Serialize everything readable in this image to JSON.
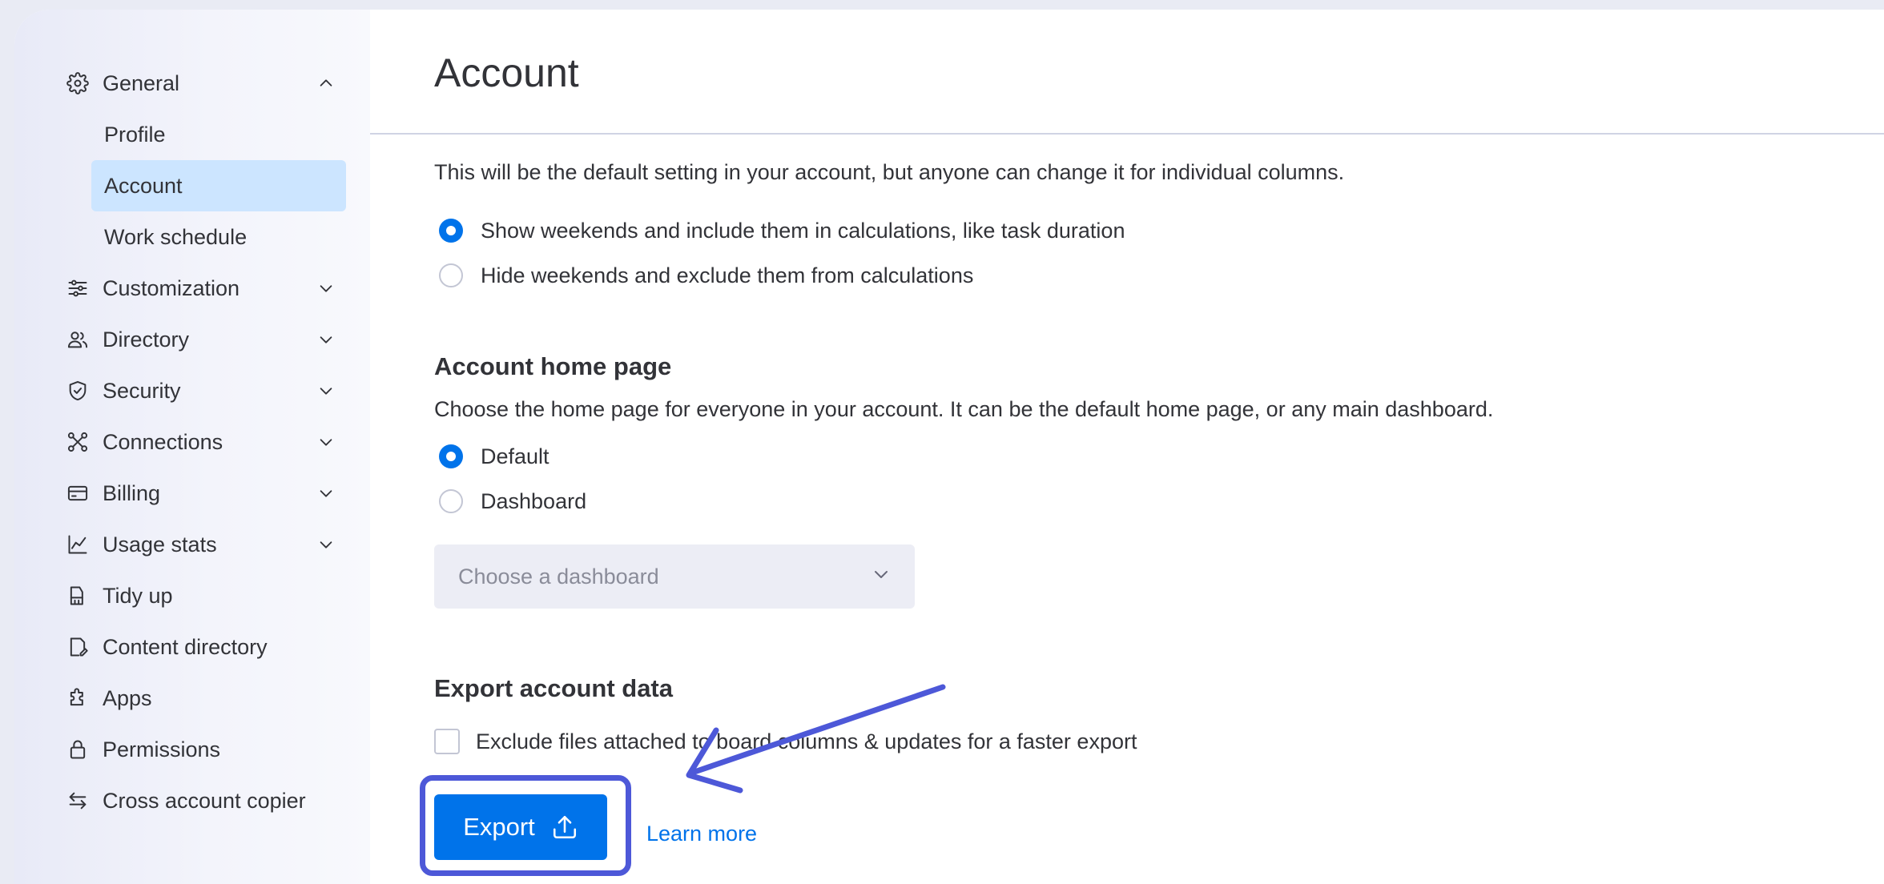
{
  "sidebar": {
    "items": [
      {
        "label": "General",
        "icon": "gear-icon",
        "expanded": true
      },
      {
        "label": "Customization",
        "icon": "sliders-icon"
      },
      {
        "label": "Directory",
        "icon": "users-icon"
      },
      {
        "label": "Security",
        "icon": "shield-icon"
      },
      {
        "label": "Connections",
        "icon": "connections-icon"
      },
      {
        "label": "Billing",
        "icon": "credit-card-icon"
      },
      {
        "label": "Usage stats",
        "icon": "chart-icon"
      },
      {
        "label": "Tidy up",
        "icon": "broom-icon"
      },
      {
        "label": "Content directory",
        "icon": "document-icon"
      },
      {
        "label": "Apps",
        "icon": "puzzle-icon"
      },
      {
        "label": "Permissions",
        "icon": "lock-icon"
      },
      {
        "label": "Cross account copier",
        "icon": "swap-arrows-icon"
      }
    ],
    "general_sub": [
      "Profile",
      "Account",
      "Work schedule"
    ],
    "active_sub": "Account"
  },
  "main": {
    "title": "Account",
    "weekend_description": "This will be the default setting in your account, but anyone can change it for individual columns.",
    "weekend_options": [
      {
        "label": "Show weekends and include them in calculations, like task duration",
        "checked": true
      },
      {
        "label": "Hide weekends and exclude them from calculations",
        "checked": false
      }
    ],
    "home_page": {
      "title": "Account home page",
      "description": "Choose the home page for everyone in your account. It can be the default home page, or any main dashboard.",
      "options": [
        {
          "label": "Default",
          "checked": true
        },
        {
          "label": "Dashboard",
          "checked": false
        }
      ],
      "select_placeholder": "Choose a dashboard"
    },
    "export": {
      "title": "Export account data",
      "checkbox_label": "Exclude files attached to board columns & updates for a faster export",
      "button_label": "Export",
      "learn_more": "Learn more"
    }
  },
  "colors": {
    "primary": "#0073ea",
    "active_bg": "#cce5ff",
    "annotation": "#4d58d8"
  }
}
